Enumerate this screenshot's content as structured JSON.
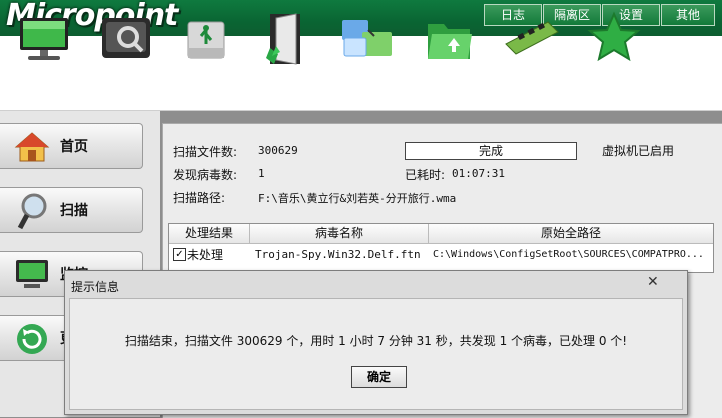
{
  "app": {
    "logo_text": "Micropoint"
  },
  "top_nav": [
    {
      "label": "日志"
    },
    {
      "label": "隔离区"
    },
    {
      "label": "设置"
    },
    {
      "label": "其他"
    }
  ],
  "toolbar": {
    "icons": [
      "monitor-icon",
      "disk-scan-icon",
      "usb-drive-icon",
      "door-exit-icon",
      "folder-network-icon",
      "folder-green-icon",
      "memory-chip-icon",
      "star-icon"
    ]
  },
  "sidebar": {
    "items": [
      {
        "label": "首页",
        "icon": "home-icon"
      },
      {
        "label": "扫描",
        "icon": "magnifier-icon"
      },
      {
        "label": "监控",
        "icon": "monitor-icon"
      },
      {
        "label": "更新",
        "icon": "refresh-icon"
      }
    ]
  },
  "scan_info": {
    "files_label": "扫描文件数:",
    "files_value": "300629",
    "virus_label": "发现病毒数:",
    "virus_value": "1",
    "path_label": "扫描路径:",
    "path_value": "F:\\音乐\\黄立行&刘若英-分开旅行.wma",
    "progress_text": "完成",
    "progress": 1.0,
    "vm_status": "虚拟机已启用",
    "elapsed_label": "已耗时:",
    "elapsed_value": "01:07:31"
  },
  "results_table": {
    "columns": [
      "处理结果",
      "病毒名称",
      "原始全路径"
    ],
    "rows": [
      {
        "checked": true,
        "result": "未处理",
        "virus": "Trojan-Spy.Win32.Delf.ftn",
        "path": "C:\\Windows\\ConfigSetRoot\\SOURCES\\COMPATPRO..."
      }
    ]
  },
  "dialog": {
    "title": "提示信息",
    "close": "✕",
    "message": "扫描结束，扫描文件 300629 个，用时 1 小时 7 分钟 31 秒，共发现 1 个病毒，已处理 0 个!",
    "ok_label": "确定"
  }
}
